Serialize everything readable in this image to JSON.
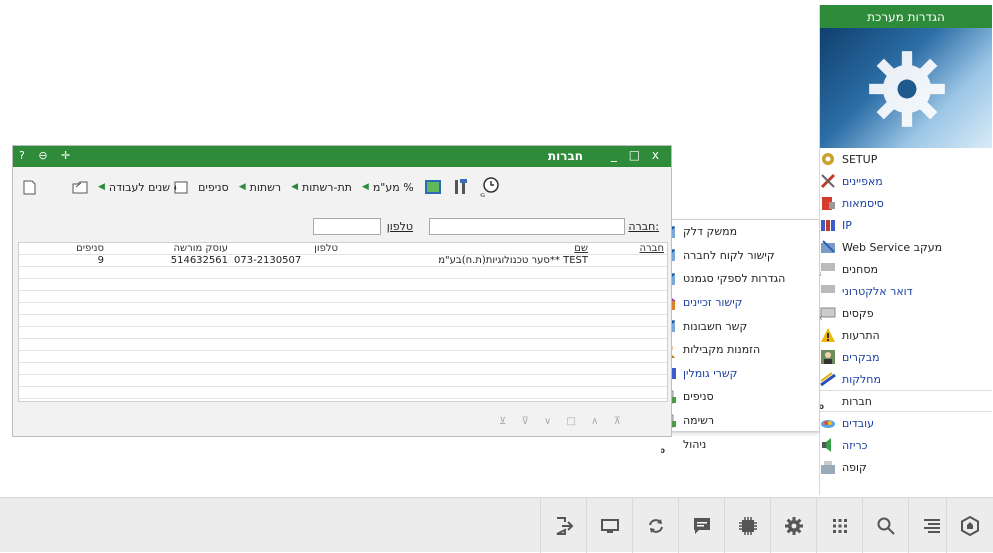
{
  "settings": {
    "title": "הגדרות מערכת",
    "items": [
      {
        "label": "SETUP",
        "icon": "setup-icon",
        "blue": false
      },
      {
        "label": "מאפיינים",
        "icon": "tools-icon",
        "blue": true
      },
      {
        "label": "סיסמאות",
        "icon": "lock-icon",
        "blue": true
      },
      {
        "label": "IP",
        "icon": "network-icon",
        "blue": true
      },
      {
        "label": "מעקב Web Service",
        "icon": "web-service-icon",
        "blue": false
      },
      {
        "label": "מסחנים",
        "icon": "sms-icon",
        "blue": false
      },
      {
        "label": "דואר אלקטרוני",
        "icon": "email-icon",
        "blue": true
      },
      {
        "label": "פקסים",
        "icon": "fax-icon",
        "blue": false
      },
      {
        "label": "התרעות",
        "icon": "warning-icon",
        "blue": false
      },
      {
        "label": "מבקרים",
        "icon": "visitor-icon",
        "blue": true
      },
      {
        "label": "מחלקות",
        "icon": "departments-icon",
        "blue": true
      },
      {
        "label": "חברות",
        "icon": "companies-icon",
        "blue": false
      },
      {
        "label": "עובדים",
        "icon": "employees-icon",
        "blue": true
      },
      {
        "label": "כריזה",
        "icon": "speaker-icon",
        "blue": true
      },
      {
        "label": "קופה",
        "icon": "cashier-icon",
        "blue": false
      }
    ]
  },
  "submenu": {
    "items": [
      {
        "label": "ממשק דלק",
        "blue": false
      },
      {
        "label": "קישור לקוח לחברה",
        "blue": false
      },
      {
        "label": "הגדרות לספקי סגמנט",
        "blue": false
      },
      {
        "label": "קישור זכיינים",
        "blue": true
      },
      {
        "label": "קשר חשבונות",
        "blue": false
      },
      {
        "label": "הזמנות מקבילות",
        "blue": false
      },
      {
        "label": "קשרי גומלין",
        "blue": true
      },
      {
        "label": "סניפים",
        "blue": false
      },
      {
        "label": "רשימה",
        "blue": false
      },
      {
        "label": "ניהול",
        "blue": false
      }
    ]
  },
  "window": {
    "title": "חברות",
    "title_controls": "_ □ x",
    "left_controls": "? ⊖ ✛",
    "toolbar": {
      "work_years": "שנים לעבודה",
      "branches": "סניפים",
      "networks": "רשתות",
      "subnetworks": "תת-רשתות",
      "vat_percent": "% מע\"מ"
    },
    "filter": {
      "company_label": "חברה:",
      "phone_label": "טלפון"
    },
    "grid": {
      "headers": {
        "company": "חברה",
        "name": "שם",
        "phone": "טלפון",
        "licensed": "עוסק מורשה",
        "branches": "סניפים"
      },
      "rows": [
        {
          "company": "",
          "name": "TEST **סער טכנולוגיות(ת.ח)בע\"מ",
          "phone": "073-2130507",
          "licensed": "514632561",
          "branches": "9"
        }
      ]
    },
    "footer_controls": "⊻ ⊽ ∨ □ ∧ ⊼"
  },
  "colors": {
    "accent": "#2e8b3a"
  }
}
